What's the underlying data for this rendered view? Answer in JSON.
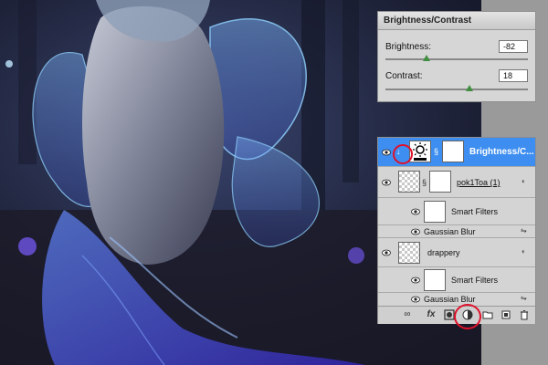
{
  "brightness_contrast": {
    "title": "Brightness/Contrast",
    "brightness_label": "Brightness:",
    "brightness_value": "-82",
    "brightness_fraction": 0.29,
    "contrast_label": "Contrast:",
    "contrast_value": "18",
    "contrast_fraction": 0.59
  },
  "layers": [
    {
      "name": "Brightness/C...",
      "type": "adjustment",
      "selected": true
    },
    {
      "name": "pok1Toa (1)",
      "type": "smart-object",
      "selected": false
    },
    {
      "name": "Smart Filters",
      "type": "filter-header",
      "selected": false
    },
    {
      "name": "Gaussian Blur",
      "type": "filter",
      "selected": false
    },
    {
      "name": "drappery",
      "type": "smart-object",
      "selected": false
    },
    {
      "name": "Smart Filters",
      "type": "filter-header",
      "selected": false
    },
    {
      "name": "Gaussian Blur",
      "type": "filter",
      "selected": false
    }
  ],
  "bottom_bar": {
    "link_icon": "link-icon",
    "fx_label": "fx",
    "mask_icon": "mask-icon",
    "adjustment_icon": "adjustment-layer-icon",
    "folder_icon": "folder-icon",
    "new_layer_icon": "new-layer-icon",
    "trash_icon": "trash-icon"
  },
  "colors": {
    "selected_layer": "#3d8ef0",
    "highlight_circle": "#e0102a"
  }
}
